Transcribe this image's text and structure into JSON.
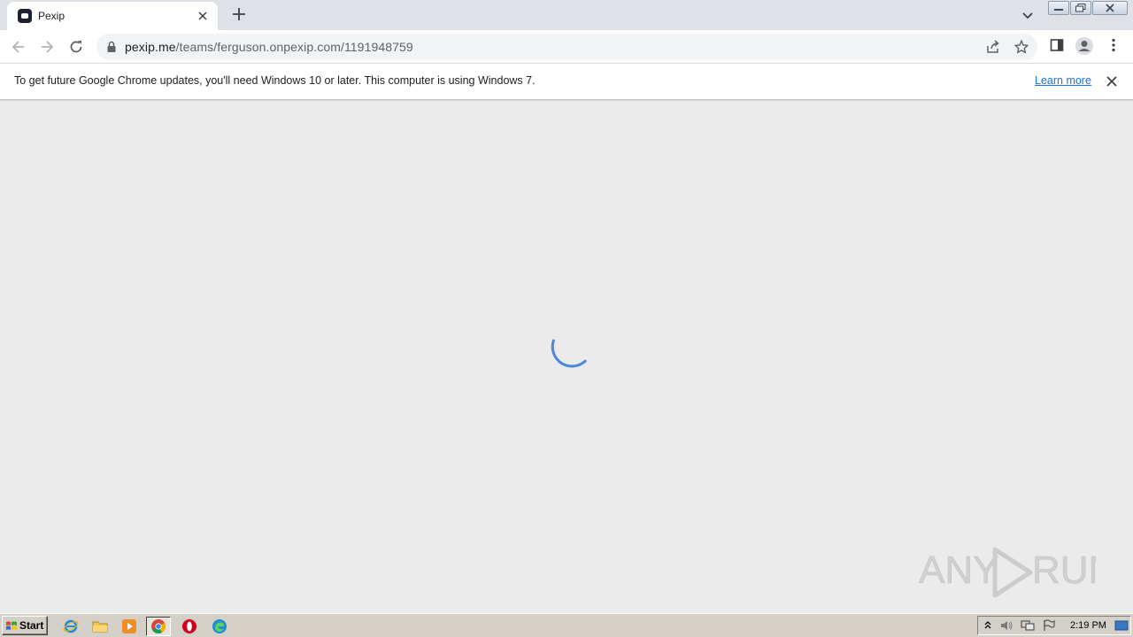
{
  "browser": {
    "tab": {
      "title": "Pexip",
      "favicon": "pexip-icon"
    },
    "address": {
      "host": "pexip.me",
      "path": "/teams/ferguson.onpexip.com/1191948759"
    }
  },
  "infobar": {
    "message": "To get future Google Chrome updates, you'll need Windows 10 or later. This computer is using Windows 7.",
    "link_label": "Learn more"
  },
  "content": {
    "state": "loading",
    "spinner_color": "#4a86e0",
    "background": "#ebebeb"
  },
  "watermark": {
    "text": "ANY RUN"
  },
  "taskbar": {
    "start_label": "Start",
    "apps": [
      "internet-explorer-icon",
      "folder-icon",
      "media-player-icon",
      "chrome-icon",
      "opera-icon",
      "edge-icon"
    ],
    "active_app": "chrome-icon",
    "clock": "2:19 PM"
  }
}
